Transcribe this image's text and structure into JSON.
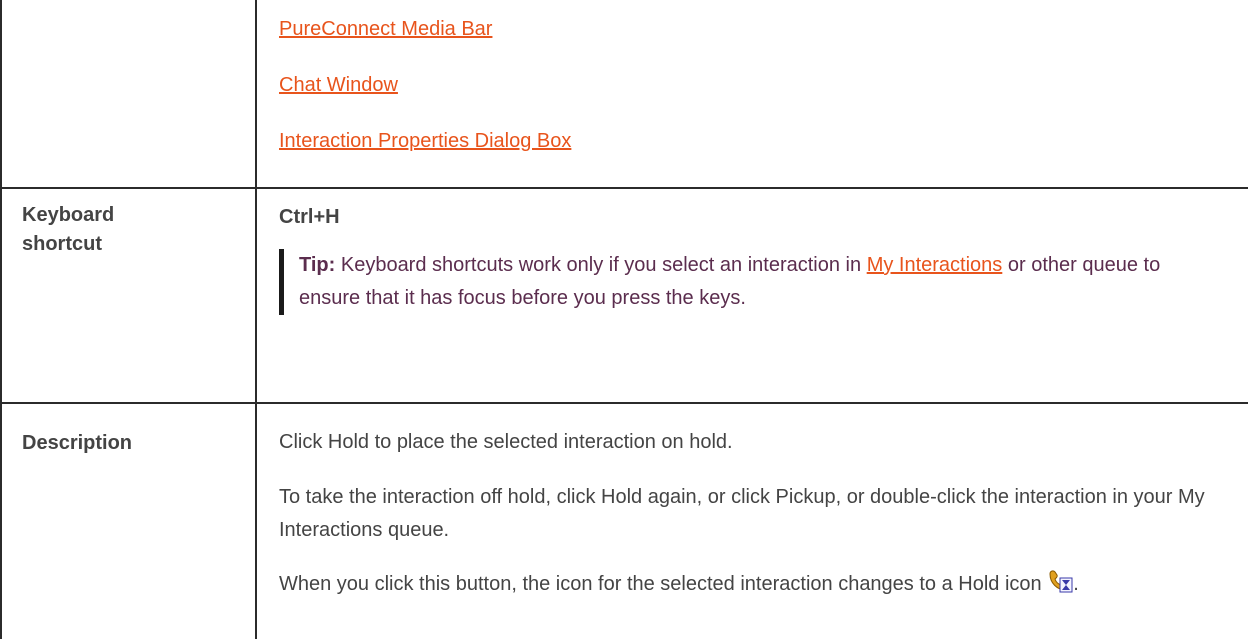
{
  "row_links": {
    "links": [
      "PureConnect Media Bar",
      "Chat Window",
      "Interaction Properties Dialog Box"
    ]
  },
  "row_shortcut": {
    "label_line1": "Keyboard",
    "label_line2": "shortcut",
    "shortcut": "Ctrl+H",
    "tip_label": "Tip:",
    "tip_text_before": " Keyboard shortcuts work only if you select an interaction in ",
    "tip_link": "My Interactions",
    "tip_text_after": " or other queue to ensure that it has focus before you press the keys."
  },
  "row_description": {
    "label": "Description",
    "p1": "Click Hold to place the selected interaction on hold.",
    "p2": "To take the interaction off hold, click Hold again, or click Pickup, or double-click the interaction in your My Interactions queue.",
    "p3": "When you click this button, the icon for the selected interaction changes to a Hold icon",
    "p3_end": "."
  },
  "colors": {
    "link": "#e8541c",
    "text": "#444444",
    "tip_text": "#5b2d4e",
    "border": "#2b2b2b"
  },
  "icons": {
    "hold": "hold-phone-hourglass-icon"
  }
}
